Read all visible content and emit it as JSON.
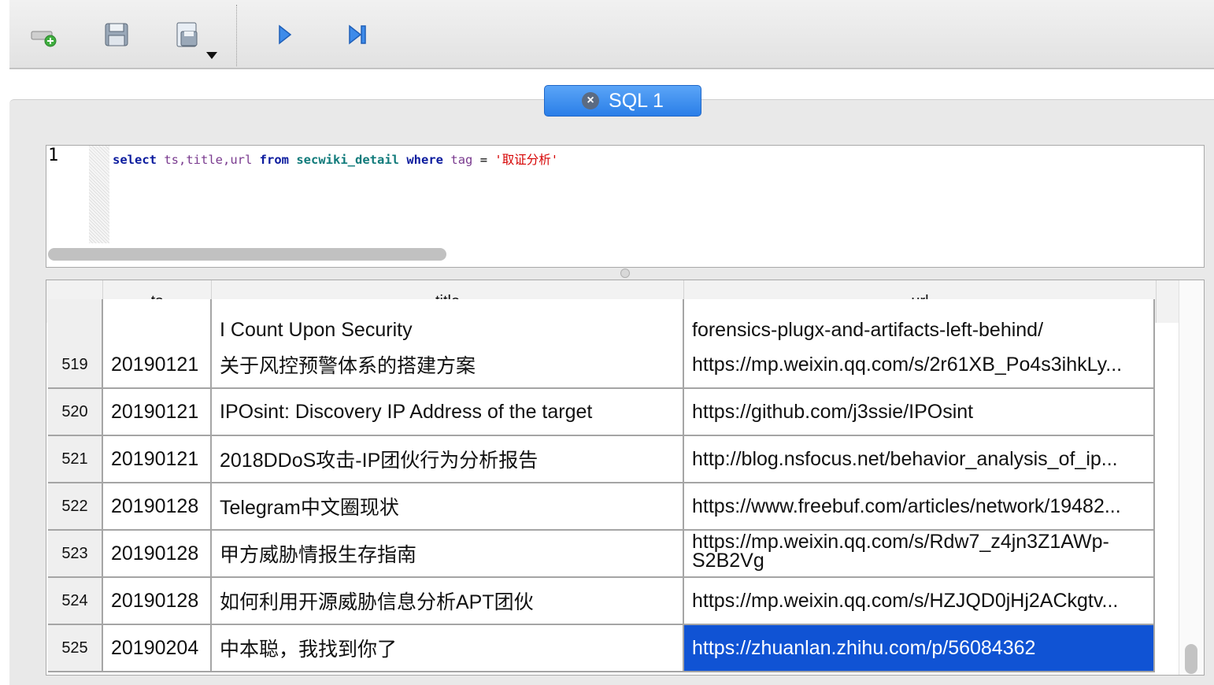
{
  "toolbar": {
    "buttons": [
      {
        "name": "add-connection-icon"
      },
      {
        "name": "save-icon"
      },
      {
        "name": "save-as-icon"
      },
      {
        "name": "run-icon"
      },
      {
        "name": "run-step-icon"
      }
    ],
    "colors": {
      "run": "#2f7fe6"
    }
  },
  "tab": {
    "label": "SQL 1",
    "close_icon": "close-icon"
  },
  "editor": {
    "line_number": "1",
    "tokens": {
      "select": "select",
      "cols": "ts,title,url",
      "from": "from",
      "table": "secwiki_detail",
      "where": "where",
      "tag": "tag",
      "eq": "=",
      "value": "'取证分析'"
    }
  },
  "results": {
    "columns": [
      "ts",
      "title",
      "url"
    ],
    "partial_row": {
      "title": "I Count Upon Security",
      "url": "forensics-plugx-and-artifacts-left-behind/"
    },
    "rows": [
      {
        "idx": "519",
        "ts": "20190121",
        "title": "关于风控预警体系的搭建方案",
        "url": "https://mp.weixin.qq.com/s/2r61XB_Po4s3ihkLy..."
      },
      {
        "idx": "520",
        "ts": "20190121",
        "title": "IPOsint: Discovery IP Address of the target",
        "url": "https://github.com/j3ssie/IPOsint"
      },
      {
        "idx": "521",
        "ts": "20190121",
        "title": "2018DDoS攻击-IP团伙行为分析报告",
        "url": "http://blog.nsfocus.net/behavior_analysis_of_ip..."
      },
      {
        "idx": "522",
        "ts": "20190128",
        "title": "Telegram中文圈现状",
        "url": "https://www.freebuf.com/articles/network/19482..."
      },
      {
        "idx": "523",
        "ts": "20190128",
        "title": "甲方威胁情报生存指南",
        "url": "https://mp.weixin.qq.com/s/Rdw7_z4jn3Z1AWp-S2B2Vg"
      },
      {
        "idx": "524",
        "ts": "20190128",
        "title": "如何利用开源威胁信息分析APT团伙",
        "url": "https://mp.weixin.qq.com/s/HZJQD0jHj2ACkgtv..."
      },
      {
        "idx": "525",
        "ts": "20190204",
        "title": "中本聪，我找到你了",
        "url": "https://zhuanlan.zhihu.com/p/56084362"
      }
    ]
  }
}
